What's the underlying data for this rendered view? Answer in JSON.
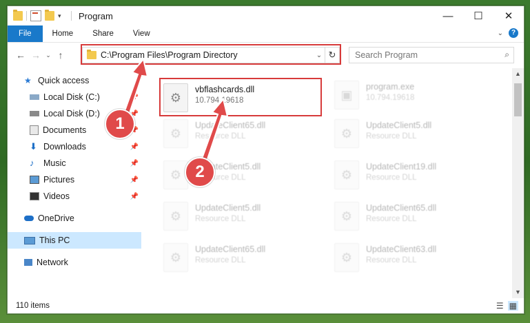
{
  "window": {
    "title": "Program"
  },
  "ribbon": {
    "tabs": [
      "File",
      "Home",
      "Share",
      "View"
    ]
  },
  "address": {
    "path": "C:\\Program Files\\Program Directory"
  },
  "search": {
    "placeholder": "Search Program"
  },
  "nav": {
    "items": [
      {
        "label": "Quick access",
        "icon": "star-icon"
      },
      {
        "label": "Local Disk (C:)",
        "icon": "drive-icon"
      },
      {
        "label": "Local Disk (D:)",
        "icon": "drive-icon"
      },
      {
        "label": "Documents",
        "icon": "documents-icon"
      },
      {
        "label": "Downloads",
        "icon": "downloads-icon"
      },
      {
        "label": "Music",
        "icon": "music-icon"
      },
      {
        "label": "Pictures",
        "icon": "pictures-icon"
      },
      {
        "label": "Videos",
        "icon": "videos-icon"
      },
      {
        "label": "OneDrive",
        "icon": "cloud-icon"
      },
      {
        "label": "This PC",
        "icon": "computer-icon"
      },
      {
        "label": "Network",
        "icon": "network-icon"
      }
    ]
  },
  "files": [
    {
      "name": "vbflashcards.dll",
      "desc": "10.794.19618"
    },
    {
      "name": "program.exe",
      "desc": "10.794.19618"
    },
    {
      "name": "UpdateClient65.dll",
      "desc": "Resource DLL"
    },
    {
      "name": "UpdateClient5.dll",
      "desc": "Resource DLL"
    },
    {
      "name": "UpdateClient5.dll",
      "desc": "Resource DLL"
    },
    {
      "name": "UpdateClient19.dll",
      "desc": "Resource DLL"
    },
    {
      "name": "UpdateClient5.dll",
      "desc": "Resource DLL"
    },
    {
      "name": "UpdateClient65.dll",
      "desc": "Resource DLL"
    },
    {
      "name": "UpdateClient65.dll",
      "desc": "Resource DLL"
    },
    {
      "name": "UpdateClient63.dll",
      "desc": "Resource DLL"
    }
  ],
  "status": {
    "count": "110 items"
  },
  "annotations": {
    "step1": "1",
    "step2": "2"
  },
  "colors": {
    "accent": "#1979ca",
    "highlight": "#d73a3a",
    "selected": "#cce8ff"
  }
}
